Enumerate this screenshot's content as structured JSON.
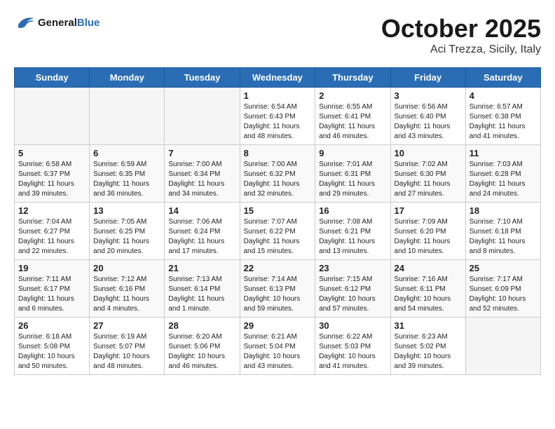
{
  "header": {
    "logo_line1": "General",
    "logo_line2": "Blue",
    "month": "October 2025",
    "location": "Aci Trezza, Sicily, Italy"
  },
  "weekdays": [
    "Sunday",
    "Monday",
    "Tuesday",
    "Wednesday",
    "Thursday",
    "Friday",
    "Saturday"
  ],
  "weeks": [
    [
      {
        "day": "",
        "info": ""
      },
      {
        "day": "",
        "info": ""
      },
      {
        "day": "",
        "info": ""
      },
      {
        "day": "1",
        "info": "Sunrise: 6:54 AM\nSunset: 6:43 PM\nDaylight: 11 hours\nand 48 minutes."
      },
      {
        "day": "2",
        "info": "Sunrise: 6:55 AM\nSunset: 6:41 PM\nDaylight: 11 hours\nand 46 minutes."
      },
      {
        "day": "3",
        "info": "Sunrise: 6:56 AM\nSunset: 6:40 PM\nDaylight: 11 hours\nand 43 minutes."
      },
      {
        "day": "4",
        "info": "Sunrise: 6:57 AM\nSunset: 6:38 PM\nDaylight: 11 hours\nand 41 minutes."
      }
    ],
    [
      {
        "day": "5",
        "info": "Sunrise: 6:58 AM\nSunset: 6:37 PM\nDaylight: 11 hours\nand 39 minutes."
      },
      {
        "day": "6",
        "info": "Sunrise: 6:59 AM\nSunset: 6:35 PM\nDaylight: 11 hours\nand 36 minutes."
      },
      {
        "day": "7",
        "info": "Sunrise: 7:00 AM\nSunset: 6:34 PM\nDaylight: 11 hours\nand 34 minutes."
      },
      {
        "day": "8",
        "info": "Sunrise: 7:00 AM\nSunset: 6:32 PM\nDaylight: 11 hours\nand 32 minutes."
      },
      {
        "day": "9",
        "info": "Sunrise: 7:01 AM\nSunset: 6:31 PM\nDaylight: 11 hours\nand 29 minutes."
      },
      {
        "day": "10",
        "info": "Sunrise: 7:02 AM\nSunset: 6:30 PM\nDaylight: 11 hours\nand 27 minutes."
      },
      {
        "day": "11",
        "info": "Sunrise: 7:03 AM\nSunset: 6:28 PM\nDaylight: 11 hours\nand 24 minutes."
      }
    ],
    [
      {
        "day": "12",
        "info": "Sunrise: 7:04 AM\nSunset: 6:27 PM\nDaylight: 11 hours\nand 22 minutes."
      },
      {
        "day": "13",
        "info": "Sunrise: 7:05 AM\nSunset: 6:25 PM\nDaylight: 11 hours\nand 20 minutes."
      },
      {
        "day": "14",
        "info": "Sunrise: 7:06 AM\nSunset: 6:24 PM\nDaylight: 11 hours\nand 17 minutes."
      },
      {
        "day": "15",
        "info": "Sunrise: 7:07 AM\nSunset: 6:22 PM\nDaylight: 11 hours\nand 15 minutes."
      },
      {
        "day": "16",
        "info": "Sunrise: 7:08 AM\nSunset: 6:21 PM\nDaylight: 11 hours\nand 13 minutes."
      },
      {
        "day": "17",
        "info": "Sunrise: 7:09 AM\nSunset: 6:20 PM\nDaylight: 11 hours\nand 10 minutes."
      },
      {
        "day": "18",
        "info": "Sunrise: 7:10 AM\nSunset: 6:18 PM\nDaylight: 11 hours\nand 8 minutes."
      }
    ],
    [
      {
        "day": "19",
        "info": "Sunrise: 7:11 AM\nSunset: 6:17 PM\nDaylight: 11 hours\nand 6 minutes."
      },
      {
        "day": "20",
        "info": "Sunrise: 7:12 AM\nSunset: 6:16 PM\nDaylight: 11 hours\nand 4 minutes."
      },
      {
        "day": "21",
        "info": "Sunrise: 7:13 AM\nSunset: 6:14 PM\nDaylight: 11 hours\nand 1 minute."
      },
      {
        "day": "22",
        "info": "Sunrise: 7:14 AM\nSunset: 6:13 PM\nDaylight: 10 hours\nand 59 minutes."
      },
      {
        "day": "23",
        "info": "Sunrise: 7:15 AM\nSunset: 6:12 PM\nDaylight: 10 hours\nand 57 minutes."
      },
      {
        "day": "24",
        "info": "Sunrise: 7:16 AM\nSunset: 6:11 PM\nDaylight: 10 hours\nand 54 minutes."
      },
      {
        "day": "25",
        "info": "Sunrise: 7:17 AM\nSunset: 6:09 PM\nDaylight: 10 hours\nand 52 minutes."
      }
    ],
    [
      {
        "day": "26",
        "info": "Sunrise: 6:18 AM\nSunset: 5:08 PM\nDaylight: 10 hours\nand 50 minutes."
      },
      {
        "day": "27",
        "info": "Sunrise: 6:19 AM\nSunset: 5:07 PM\nDaylight: 10 hours\nand 48 minutes."
      },
      {
        "day": "28",
        "info": "Sunrise: 6:20 AM\nSunset: 5:06 PM\nDaylight: 10 hours\nand 46 minutes."
      },
      {
        "day": "29",
        "info": "Sunrise: 6:21 AM\nSunset: 5:04 PM\nDaylight: 10 hours\nand 43 minutes."
      },
      {
        "day": "30",
        "info": "Sunrise: 6:22 AM\nSunset: 5:03 PM\nDaylight: 10 hours\nand 41 minutes."
      },
      {
        "day": "31",
        "info": "Sunrise: 6:23 AM\nSunset: 5:02 PM\nDaylight: 10 hours\nand 39 minutes."
      },
      {
        "day": "",
        "info": ""
      }
    ]
  ]
}
